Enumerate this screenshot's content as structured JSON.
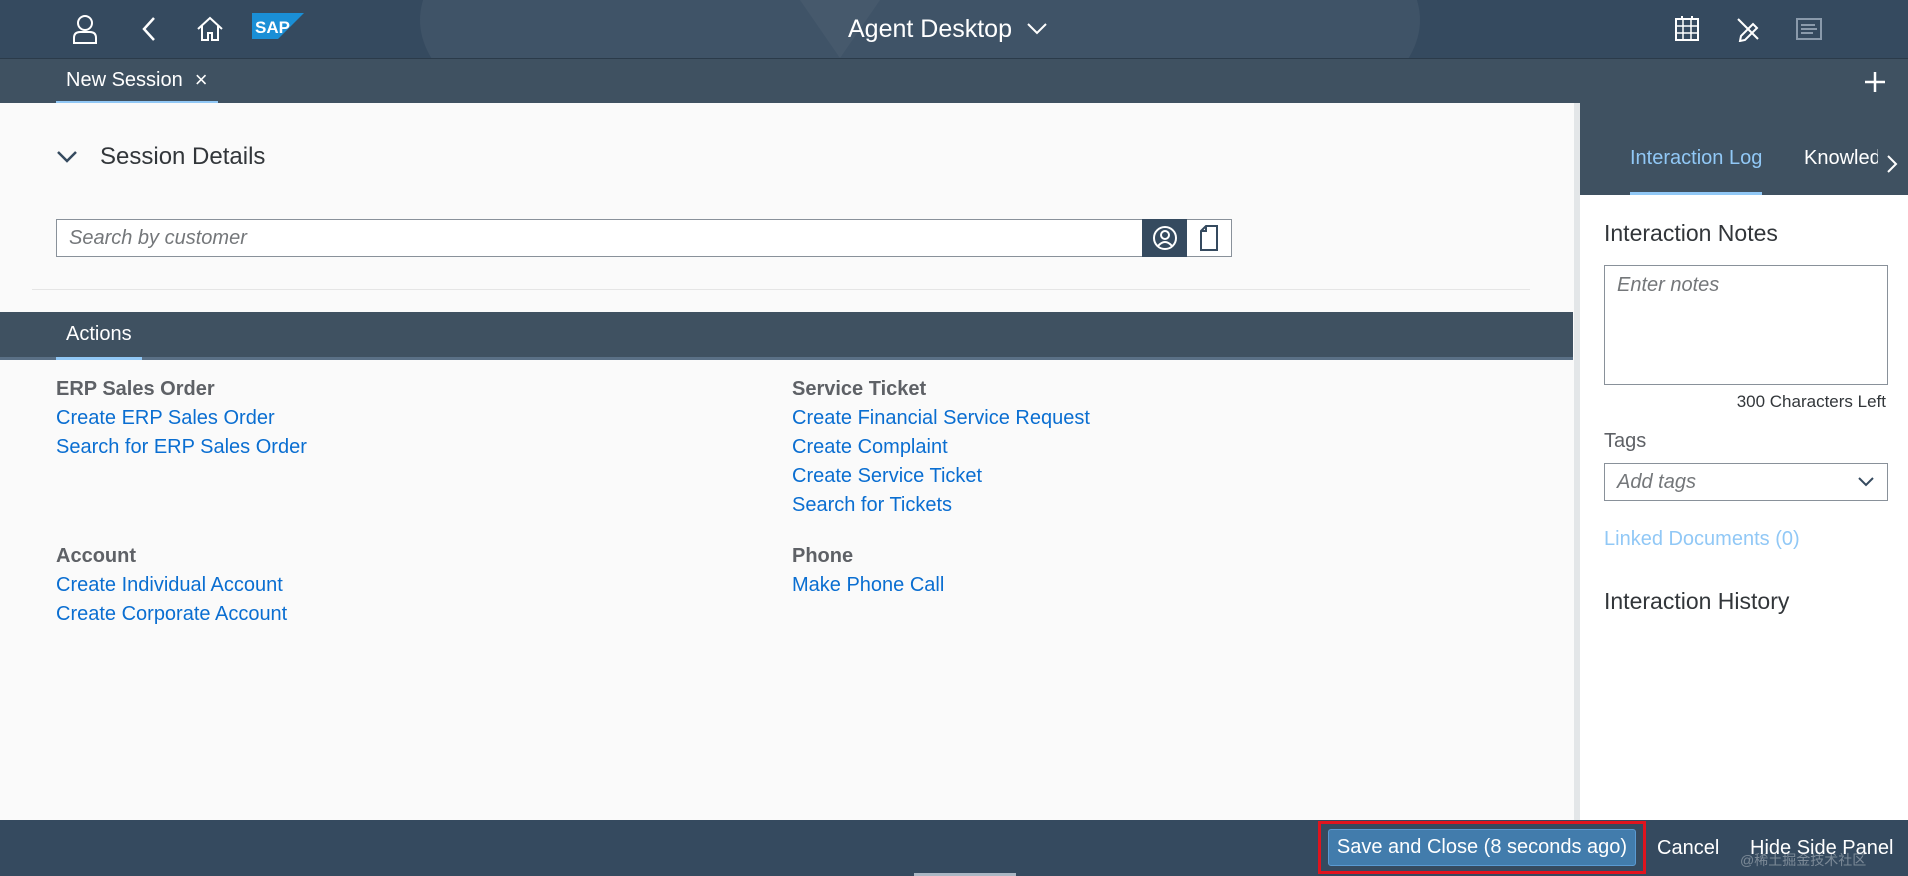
{
  "shell": {
    "title": "Agent Desktop",
    "logo_text": "SAP",
    "icons": [
      "user-icon",
      "back-icon",
      "home-icon",
      "grid-calendar-icon",
      "edit-off-icon",
      "toggle-panel-icon"
    ]
  },
  "tabs": {
    "session_label": "New Session",
    "close_glyph": "×",
    "add_glyph": "+"
  },
  "session": {
    "heading": "Session Details",
    "search_placeholder": "Search by customer"
  },
  "actions": {
    "tab_label": "Actions",
    "groups": [
      {
        "title": "ERP Sales Order",
        "links": [
          "Create ERP Sales Order",
          "Search for ERP Sales Order"
        ]
      },
      {
        "title": "Service Ticket",
        "links": [
          "Create Financial Service Request",
          "Create Complaint",
          "Create Service Ticket",
          "Search for Tickets"
        ]
      },
      {
        "title": "Account",
        "links": [
          "Create Individual Account",
          "Create Corporate Account"
        ]
      },
      {
        "title": "Phone",
        "links": [
          "Make Phone Call"
        ]
      }
    ]
  },
  "side_panel": {
    "tabs": [
      "Interaction Log",
      "Knowledge"
    ],
    "notes_heading": "Interaction Notes",
    "notes_placeholder": "Enter notes",
    "chars_left": "300 Characters Left",
    "tags_label": "Tags",
    "tags_placeholder": "Add tags",
    "linked_documents": "Linked Documents (0)",
    "history_heading": "Interaction History"
  },
  "footer": {
    "save_close": "Save and Close (8 seconds ago)",
    "cancel": "Cancel",
    "hide_side_panel": "Hide Side Panel"
  },
  "watermark": "@稀土掘金技术社区",
  "colors": {
    "shell": "#354a5f",
    "bar": "#3f5161",
    "link": "#0a6ed1",
    "accent": "#91c8f6",
    "highlight": "#e0141e"
  }
}
